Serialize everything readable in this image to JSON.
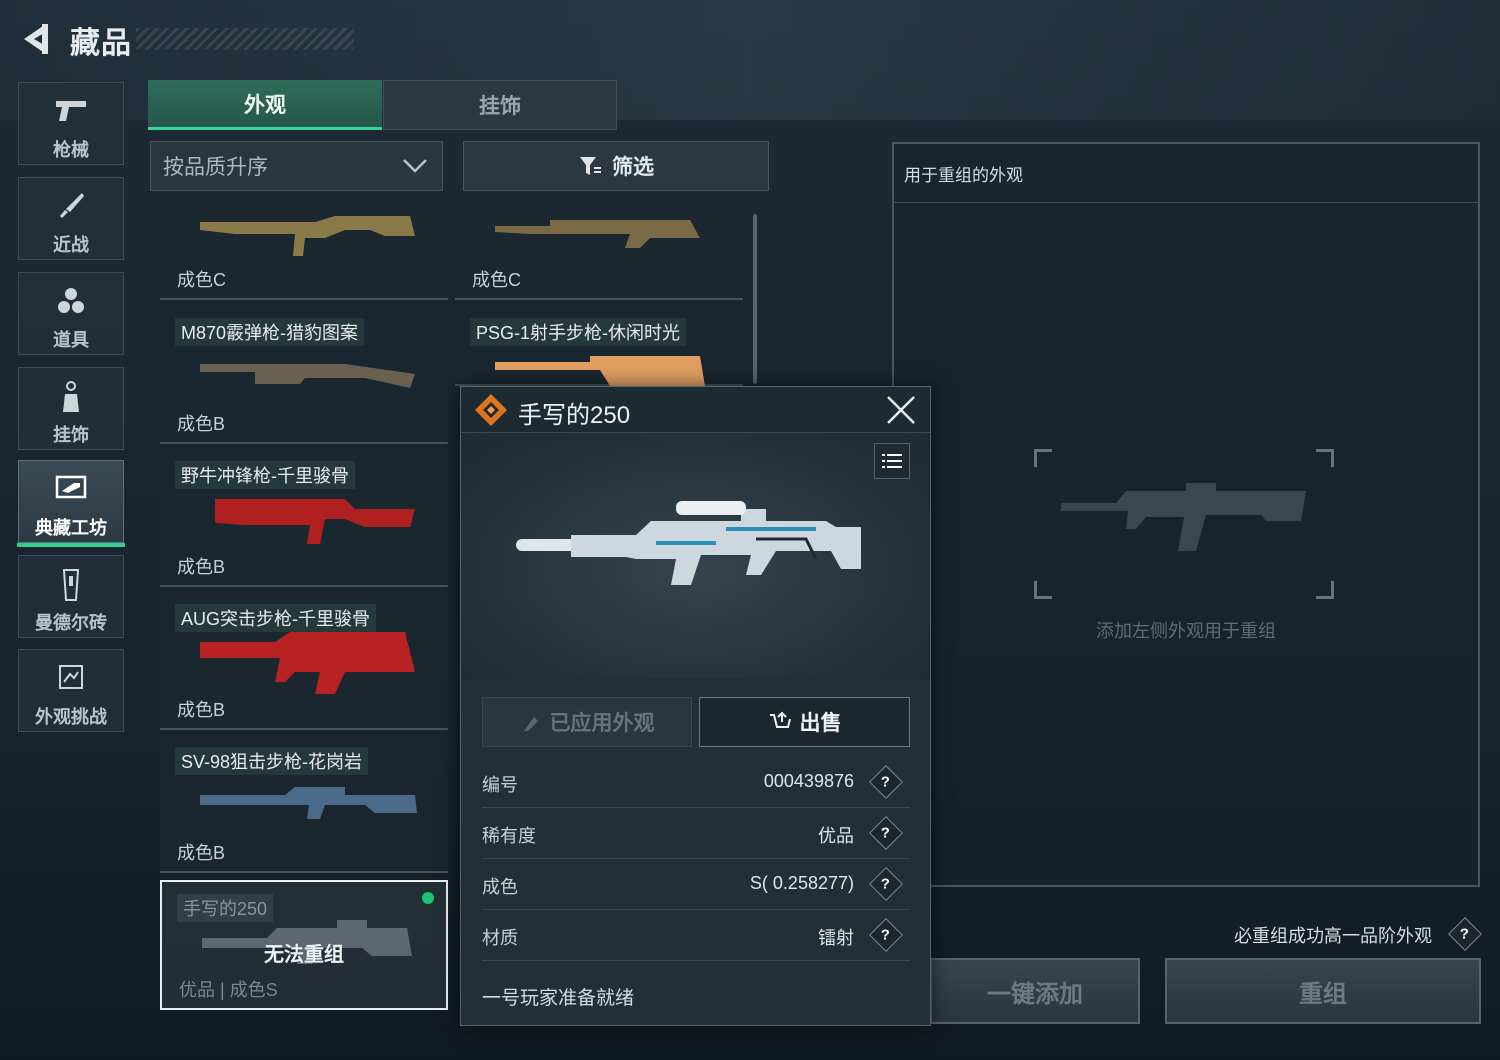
{
  "header": {
    "title": "藏品"
  },
  "rail": [
    {
      "label": "枪械",
      "icon": "gun-icon"
    },
    {
      "label": "近战",
      "icon": "knife-icon"
    },
    {
      "label": "道具",
      "icon": "grenade-icon"
    },
    {
      "label": "挂饰",
      "icon": "charm-icon"
    },
    {
      "label": "典藏工坊",
      "icon": "workshop-icon",
      "active": true
    },
    {
      "label": "曼德尔砖",
      "icon": "brick-icon"
    },
    {
      "label": "外观挑战",
      "icon": "challenge-icon"
    }
  ],
  "tabs": [
    {
      "label": "外观",
      "active": true
    },
    {
      "label": "挂饰",
      "active": false
    }
  ],
  "sort": {
    "value": "按品质升序"
  },
  "filter": {
    "label": "筛选"
  },
  "items": [
    {
      "name": "",
      "grade": "成色C",
      "color": "#8a7a4a"
    },
    {
      "name": "",
      "grade": "成色C",
      "color": "#7a6a45"
    },
    {
      "name": "M870霰弹枪-猎豹图案",
      "grade": "成色B",
      "color": "#6a6050"
    },
    {
      "name": "PSG-1射手步枪-休闲时光",
      "grade": "",
      "color": "#e0a060"
    },
    {
      "name": "野牛冲锋枪-千里骏骨",
      "grade": "成色B",
      "color": "#b02020"
    },
    {
      "name": "AUG突击步枪-千里骏骨",
      "grade": "成色B",
      "color": "#b82222"
    },
    {
      "name": "SV-98狙击步枪-花岗岩",
      "grade": "成色B",
      "color": "#4b6a8a"
    },
    {
      "name": "手写的250",
      "grade": "优品 | 成色S",
      "overlay": "无法重组",
      "color": "#8c98a0",
      "selected": true
    }
  ],
  "popup": {
    "title": "手写的250",
    "applied_label": "已应用外观",
    "sell_label": "出售",
    "rows": [
      {
        "key": "编号",
        "value": "000439876"
      },
      {
        "key": "稀有度",
        "value": "优品"
      },
      {
        "key": "成色",
        "value": "S( 0.258277)"
      },
      {
        "key": "材质",
        "value": "镭射"
      }
    ],
    "footnote": "一号玩家准备就绪"
  },
  "recombine": {
    "title": "用于重组的外观",
    "hint": "添加左侧外观用于重组",
    "must_note": "必重组成功高一品阶外观",
    "add_all_label": "一键添加",
    "recombine_label": "重组"
  },
  "help_glyph": "?",
  "colors": {
    "accent_green": "#2fd08e",
    "tab_active": "#2f6d5a",
    "panel": "#232f37"
  }
}
